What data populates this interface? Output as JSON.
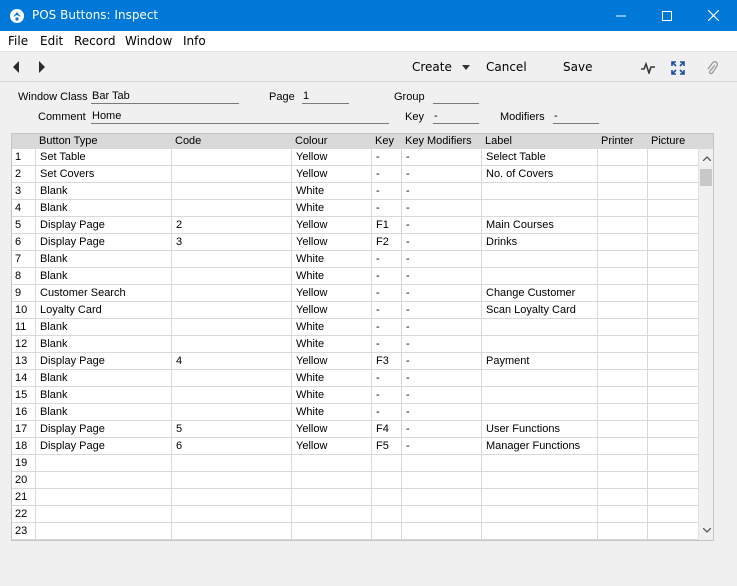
{
  "window": {
    "title": "POS Buttons: Inspect",
    "accent_color": "#0078d7"
  },
  "menu": {
    "items": [
      "File",
      "Edit",
      "Record",
      "Window",
      "Info"
    ]
  },
  "toolbar": {
    "create_label": "Create",
    "cancel_label": "Cancel",
    "save_label": "Save"
  },
  "header": {
    "window_class_label": "Window Class",
    "window_class_value": "Bar Tab",
    "page_label": "Page",
    "page_value": "1",
    "group_label": "Group",
    "group_value": "",
    "comment_label": "Comment",
    "comment_value": "Home",
    "key_label": "Key",
    "key_value": "-",
    "modifiers_label": "Modifiers",
    "modifiers_value": "-"
  },
  "table": {
    "columns": [
      "Button Type",
      "Code",
      "Colour",
      "Key",
      "Key Modifiers",
      "Label",
      "Printer",
      "Picture"
    ],
    "rows": [
      {
        "n": "1",
        "type": "Set Table",
        "code": "",
        "colour": "Yellow",
        "key": "-",
        "mods": "-",
        "label": "Select Table"
      },
      {
        "n": "2",
        "type": "Set Covers",
        "code": "",
        "colour": "Yellow",
        "key": "-",
        "mods": "-",
        "label": "No. of  Covers"
      },
      {
        "n": "3",
        "type": "Blank",
        "code": "",
        "colour": "White",
        "key": "-",
        "mods": "-",
        "label": ""
      },
      {
        "n": "4",
        "type": "Blank",
        "code": "",
        "colour": "White",
        "key": "-",
        "mods": "-",
        "label": ""
      },
      {
        "n": "5",
        "type": "Display Page",
        "code": "2",
        "colour": "Yellow",
        "key": "F1",
        "mods": "-",
        "label": "Main Courses"
      },
      {
        "n": "6",
        "type": "Display Page",
        "code": "3",
        "colour": "Yellow",
        "key": "F2",
        "mods": "-",
        "label": "Drinks"
      },
      {
        "n": "7",
        "type": "Blank",
        "code": "",
        "colour": "White",
        "key": "-",
        "mods": "-",
        "label": ""
      },
      {
        "n": "8",
        "type": "Blank",
        "code": "",
        "colour": "White",
        "key": "-",
        "mods": "-",
        "label": ""
      },
      {
        "n": "9",
        "type": "Customer Search",
        "code": "",
        "colour": "Yellow",
        "key": "-",
        "mods": "-",
        "label": "Change Customer"
      },
      {
        "n": "10",
        "type": "Loyalty Card",
        "code": "",
        "colour": "Yellow",
        "key": "-",
        "mods": "-",
        "label": "Scan Loyalty Card"
      },
      {
        "n": "11",
        "type": "Blank",
        "code": "",
        "colour": "White",
        "key": "-",
        "mods": "-",
        "label": ""
      },
      {
        "n": "12",
        "type": "Blank",
        "code": "",
        "colour": "White",
        "key": "-",
        "mods": "-",
        "label": ""
      },
      {
        "n": "13",
        "type": "Display Page",
        "code": "4",
        "colour": "Yellow",
        "key": "F3",
        "mods": "-",
        "label": "Payment"
      },
      {
        "n": "14",
        "type": "Blank",
        "code": "",
        "colour": "White",
        "key": "-",
        "mods": "-",
        "label": ""
      },
      {
        "n": "15",
        "type": "Blank",
        "code": "",
        "colour": "White",
        "key": "-",
        "mods": "-",
        "label": ""
      },
      {
        "n": "16",
        "type": "Blank",
        "code": "",
        "colour": "White",
        "key": "-",
        "mods": "-",
        "label": ""
      },
      {
        "n": "17",
        "type": "Display Page",
        "code": "5",
        "colour": "Yellow",
        "key": "F4",
        "mods": "-",
        "label": "User Functions"
      },
      {
        "n": "18",
        "type": "Display Page",
        "code": "6",
        "colour": "Yellow",
        "key": "F5",
        "mods": "-",
        "label": "Manager Functions"
      },
      {
        "n": "19",
        "type": "",
        "code": "",
        "colour": "",
        "key": "",
        "mods": "",
        "label": ""
      },
      {
        "n": "20",
        "type": "",
        "code": "",
        "colour": "",
        "key": "",
        "mods": "",
        "label": ""
      },
      {
        "n": "21",
        "type": "",
        "code": "",
        "colour": "",
        "key": "",
        "mods": "",
        "label": ""
      },
      {
        "n": "22",
        "type": "",
        "code": "",
        "colour": "",
        "key": "",
        "mods": "",
        "label": ""
      },
      {
        "n": "23",
        "type": "",
        "code": "",
        "colour": "",
        "key": "",
        "mods": "",
        "label": ""
      }
    ]
  }
}
